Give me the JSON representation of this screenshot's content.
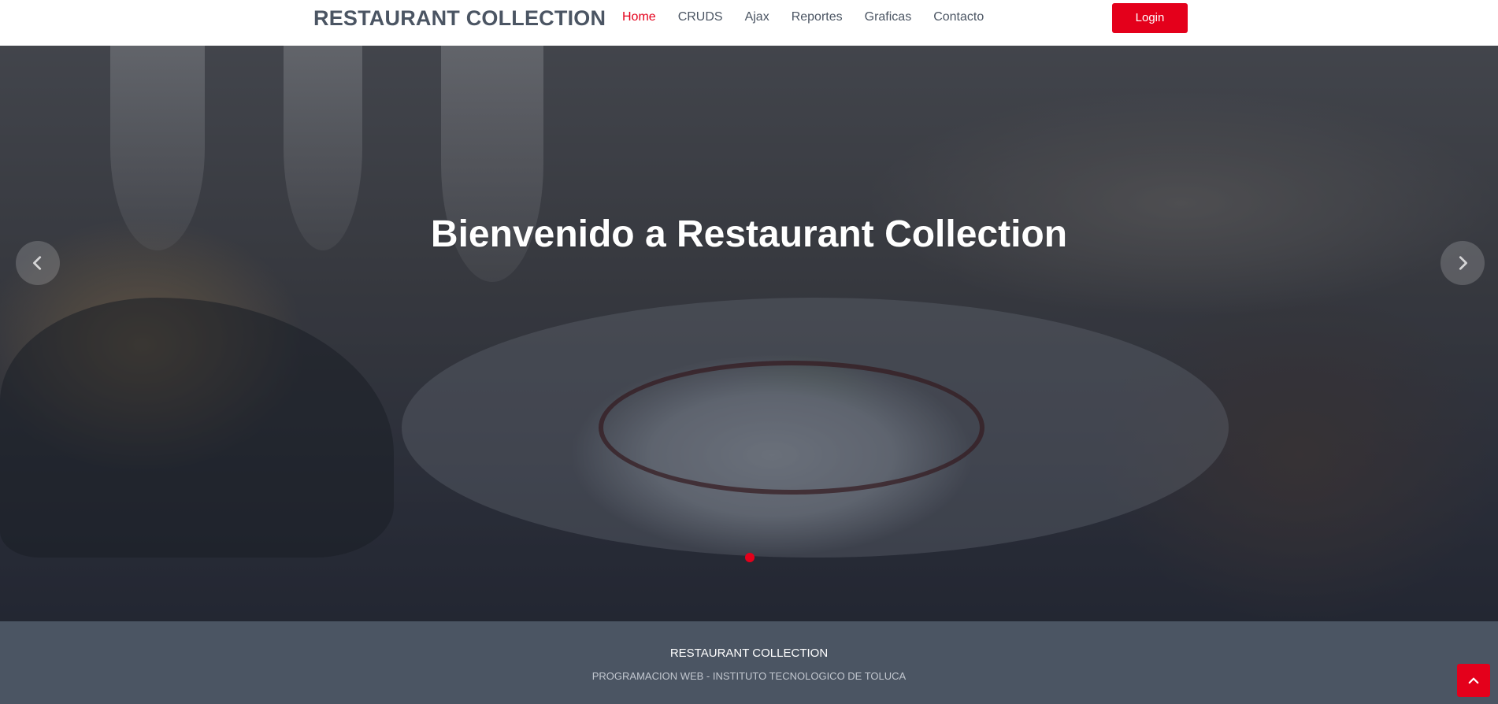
{
  "header": {
    "brand": "RESTAURANT COLLECTION",
    "nav": [
      {
        "label": "Home",
        "active": true
      },
      {
        "label": "CRUDS",
        "active": false
      },
      {
        "label": "Ajax",
        "active": false
      },
      {
        "label": "Reportes",
        "active": false
      },
      {
        "label": "Graficas",
        "active": false
      },
      {
        "label": "Contacto",
        "active": false
      }
    ],
    "login_label": "Login"
  },
  "hero": {
    "title": "Bienvenido a Restaurant Collection",
    "prev_icon": "chevron-left-icon",
    "next_icon": "chevron-right-icon",
    "slide_count": 1,
    "active_slide": 1
  },
  "footer": {
    "title": "RESTAURANT COLLECTION",
    "subtitle": "PROGRAMACION WEB - INSTITUTO TECNOLOGICO DE TOLUCA"
  },
  "scroll_top_icon": "chevron-up-icon",
  "colors": {
    "accent": "#e4001b",
    "brand_text": "#4b5563",
    "footer_bg": "#4b5563"
  }
}
